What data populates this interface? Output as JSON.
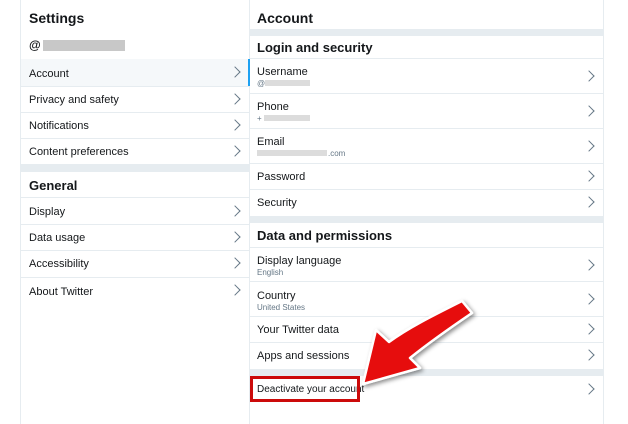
{
  "left": {
    "title": "Settings",
    "handle_prefix": "@",
    "items": [
      {
        "label": "Account"
      },
      {
        "label": "Privacy and safety"
      },
      {
        "label": "Notifications"
      },
      {
        "label": "Content preferences"
      }
    ],
    "general_title": "General",
    "general_items": [
      {
        "label": "Display"
      },
      {
        "label": "Data usage"
      },
      {
        "label": "Accessibility"
      },
      {
        "label": "About Twitter"
      }
    ]
  },
  "right": {
    "title": "Account",
    "login_section": "Login and security",
    "login_items": [
      {
        "label": "Username",
        "sub": "@"
      },
      {
        "label": "Phone",
        "sub": "+"
      },
      {
        "label": "Email",
        "sub": ".com"
      },
      {
        "label": "Password"
      },
      {
        "label": "Security"
      }
    ],
    "data_section": "Data and permissions",
    "data_items": [
      {
        "label": "Display language",
        "sub": "English"
      },
      {
        "label": "Country",
        "sub": "United States"
      },
      {
        "label": "Your Twitter data"
      },
      {
        "label": "Apps and sessions"
      }
    ],
    "deactivate": "Deactivate your account"
  },
  "colors": {
    "accent": "#1da1f2",
    "highlight": "#cc0a0a",
    "divider": "#e6ecf0"
  }
}
